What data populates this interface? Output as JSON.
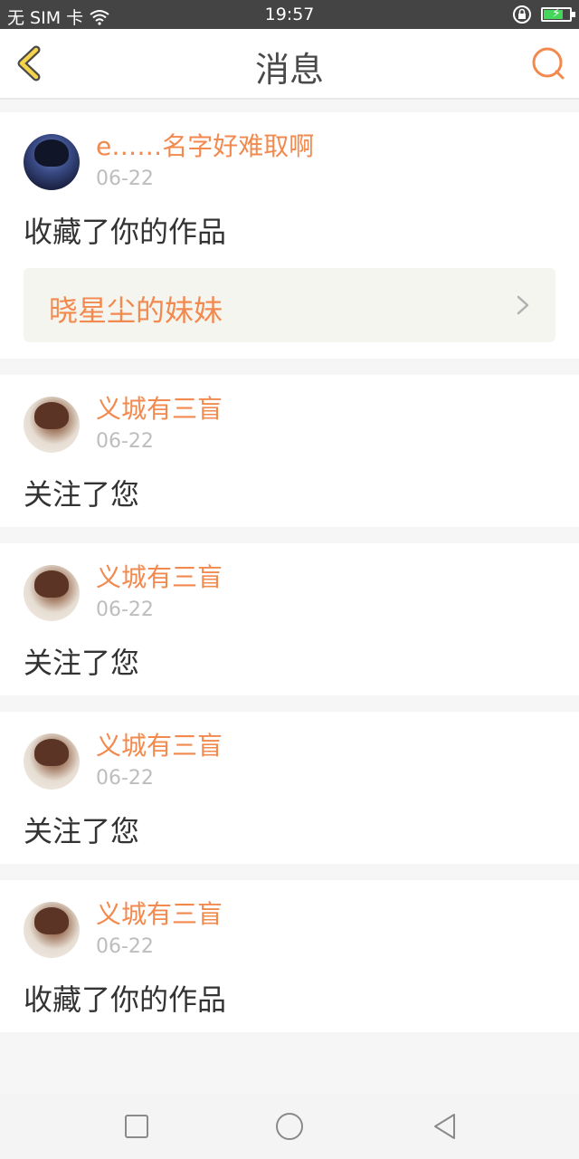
{
  "status_bar": {
    "carrier": "无 SIM 卡",
    "time": "19:57",
    "icons": [
      "wifi-icon",
      "orientation-lock-icon",
      "battery-charging-icon"
    ],
    "battery_level": 0.75
  },
  "header": {
    "title": "消息",
    "back_icon": "chevron-left-icon",
    "search_icon": "search-icon",
    "accent_color": "#f28a4f"
  },
  "messages": [
    {
      "user": "e……名字好难取啊",
      "date": "06-22",
      "action": "收藏了你的作品",
      "work": "晓星尘的妹妹"
    },
    {
      "user": "义城有三盲",
      "date": "06-22",
      "action": "关注了您"
    },
    {
      "user": "义城有三盲",
      "date": "06-22",
      "action": "关注了您"
    },
    {
      "user": "义城有三盲",
      "date": "06-22",
      "action": "关注了您"
    },
    {
      "user": "义城有三盲",
      "date": "06-22",
      "action": "收藏了你的作品"
    }
  ],
  "nav_bar": {
    "icons": [
      "recent-apps-icon",
      "home-icon",
      "back-icon"
    ]
  }
}
